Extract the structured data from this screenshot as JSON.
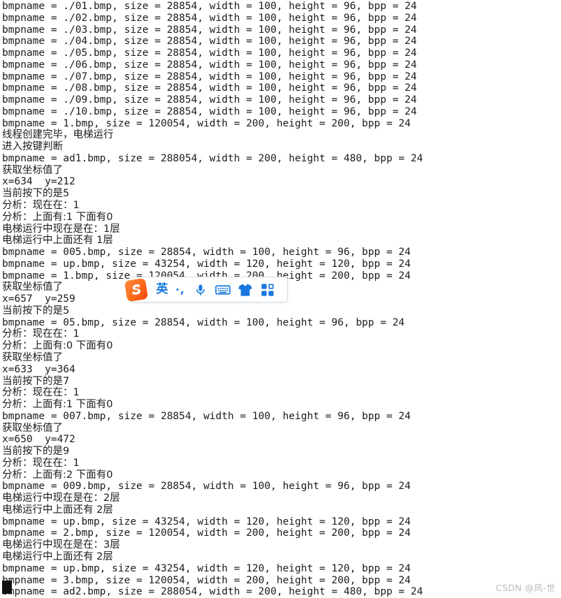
{
  "console": {
    "name": "program-console-output",
    "lines": [
      {
        "text": "bmpname = ./01.bmp, size = 28854, width = 100, height = 96, bpp = 24",
        "cjk": false
      },
      {
        "text": "bmpname = ./02.bmp, size = 28854, width = 100, height = 96, bpp = 24",
        "cjk": false
      },
      {
        "text": "bmpname = ./03.bmp, size = 28854, width = 100, height = 96, bpp = 24",
        "cjk": false
      },
      {
        "text": "bmpname = ./04.bmp, size = 28854, width = 100, height = 96, bpp = 24",
        "cjk": false
      },
      {
        "text": "bmpname = ./05.bmp, size = 28854, width = 100, height = 96, bpp = 24",
        "cjk": false
      },
      {
        "text": "bmpname = ./06.bmp, size = 28854, width = 100, height = 96, bpp = 24",
        "cjk": false
      },
      {
        "text": "bmpname = ./07.bmp, size = 28854, width = 100, height = 96, bpp = 24",
        "cjk": false
      },
      {
        "text": "bmpname = ./08.bmp, size = 28854, width = 100, height = 96, bpp = 24",
        "cjk": false
      },
      {
        "text": "bmpname = ./09.bmp, size = 28854, width = 100, height = 96, bpp = 24",
        "cjk": false
      },
      {
        "text": "bmpname = ./10.bmp, size = 28854, width = 100, height = 96, bpp = 24",
        "cjk": false
      },
      {
        "text": "bmpname = 1.bmp, size = 120054, width = 200, height = 200, bpp = 24",
        "cjk": false
      },
      {
        "text": "线程创建完毕，电梯运行",
        "cjk": true
      },
      {
        "text": "进入按键判断",
        "cjk": true
      },
      {
        "text": "bmpname = ad1.bmp, size = 288054, width = 200, height = 480, bpp = 24",
        "cjk": false
      },
      {
        "text": "获取坐标值了",
        "cjk": true
      },
      {
        "text": "x=634  y=212",
        "cjk": false
      },
      {
        "text": "当前按下的是5",
        "cjk": true
      },
      {
        "text": "分析：现在在：1",
        "cjk": true
      },
      {
        "text": "分析：上面有:1 下面有0",
        "cjk": true
      },
      {
        "text": "电梯运行中现在是在：1层",
        "cjk": true
      },
      {
        "text": "电梯运行中上面还有 1层",
        "cjk": true
      },
      {
        "text": "bmpname = 005.bmp, size = 28854, width = 100, height = 96, bpp = 24",
        "cjk": false
      },
      {
        "text": "bmpname = up.bmp, size = 43254, width = 120, height = 120, bpp = 24",
        "cjk": false
      },
      {
        "text": "bmpname = 1.bmp, size = 120054, width = 200, height = 200, bpp = 24",
        "cjk": false
      },
      {
        "text": "获取坐标值了",
        "cjk": true
      },
      {
        "text": "x=657  y=259",
        "cjk": false
      },
      {
        "text": "当前按下的是5",
        "cjk": true
      },
      {
        "text": "bmpname = 05.bmp, size = 28854, width = 100, height = 96, bpp = 24",
        "cjk": false
      },
      {
        "text": "分析：现在在：1",
        "cjk": true
      },
      {
        "text": "分析：上面有:0 下面有0",
        "cjk": true
      },
      {
        "text": "获取坐标值了",
        "cjk": true
      },
      {
        "text": "x=633  y=364",
        "cjk": false
      },
      {
        "text": "当前按下的是7",
        "cjk": true
      },
      {
        "text": "分析：现在在：1",
        "cjk": true
      },
      {
        "text": "分析：上面有:1 下面有0",
        "cjk": true
      },
      {
        "text": "bmpname = 007.bmp, size = 28854, width = 100, height = 96, bpp = 24",
        "cjk": false
      },
      {
        "text": "获取坐标值了",
        "cjk": true
      },
      {
        "text": "x=650  y=472",
        "cjk": false
      },
      {
        "text": "当前按下的是9",
        "cjk": true
      },
      {
        "text": "分析：现在在：1",
        "cjk": true
      },
      {
        "text": "分析：上面有:2 下面有0",
        "cjk": true
      },
      {
        "text": "bmpname = 009.bmp, size = 28854, width = 100, height = 96, bpp = 24",
        "cjk": false
      },
      {
        "text": "电梯运行中现在是在：2层",
        "cjk": true
      },
      {
        "text": "电梯运行中上面还有 2层",
        "cjk": true
      },
      {
        "text": "bmpname = up.bmp, size = 43254, width = 120, height = 120, bpp = 24",
        "cjk": false
      },
      {
        "text": "bmpname = 2.bmp, size = 120054, width = 200, height = 200, bpp = 24",
        "cjk": false
      },
      {
        "text": "电梯运行中现在是在：3层",
        "cjk": true
      },
      {
        "text": "电梯运行中上面还有 2层",
        "cjk": true
      },
      {
        "text": "bmpname = up.bmp, size = 43254, width = 120, height = 120, bpp = 24",
        "cjk": false
      },
      {
        "text": "bmpname = 3.bmp, size = 120054, width = 200, height = 200, bpp = 24",
        "cjk": false
      },
      {
        "text": "bmpname = ad2.bmp, size = 288054, width = 200, height = 480, bpp = 24",
        "cjk": false
      }
    ],
    "text_color": "#1c1c1c",
    "background_color": "#ffffff",
    "cursor": {
      "visible": true
    }
  },
  "ime_toolbar": {
    "logo_label": "S",
    "logo_color": "#ff6a00",
    "accent_color": "#1878e0",
    "items": [
      {
        "name": "language-mode",
        "label": "英"
      },
      {
        "name": "punctuation-mode",
        "label": "·,"
      },
      {
        "name": "voice-input",
        "label": ""
      },
      {
        "name": "soft-keyboard",
        "label": ""
      },
      {
        "name": "skin",
        "label": ""
      },
      {
        "name": "toolbox",
        "label": ""
      }
    ]
  },
  "watermark": {
    "text": "CSDN @风-世"
  }
}
